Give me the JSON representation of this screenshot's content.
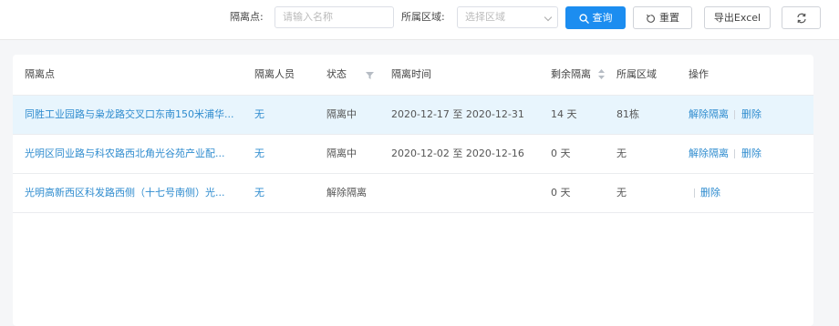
{
  "filters": {
    "site_label": "隔离点:",
    "site_placeholder": "请输入名称",
    "region_label": "所属区域:",
    "region_placeholder": "选择区域",
    "search_label": "查询",
    "reset_label": "重置",
    "export_label": "导出Excel"
  },
  "table": {
    "columns": [
      "隔离点",
      "隔离人员",
      "状态",
      "隔离时间",
      "剩余隔离",
      "所属区域",
      "操作"
    ],
    "rows": [
      {
        "site": "同胜工业园路与枭龙路交叉口东南150米浦华...",
        "person": "无",
        "status": "隔离中",
        "period": "2020-12-17 至 2020-12-31",
        "remaining": "14 天",
        "region": "81栋",
        "action1": "解除隔离",
        "action2": "删除"
      },
      {
        "site": "光明区同业路与科农路西北角光谷苑产业配...",
        "person": "无",
        "status": "隔离中",
        "period": "2020-12-02 至 2020-12-16",
        "remaining": "0 天",
        "region": "无",
        "action1": "解除隔离",
        "action2": "删除"
      },
      {
        "site": "光明高新西区科发路西侧（十七号南侧）光...",
        "person": "无",
        "status": "解除隔离",
        "period": "",
        "remaining": "0 天",
        "region": "无",
        "action1": "",
        "action2": "删除"
      }
    ]
  },
  "colors": {
    "primary": "#1c8df0",
    "link": "#2f8ccf",
    "highlight_row": "#e8f5fd"
  },
  "icons": [
    "search-icon",
    "reset-icon",
    "refresh-icon",
    "filter-icon",
    "sort-icon"
  ]
}
